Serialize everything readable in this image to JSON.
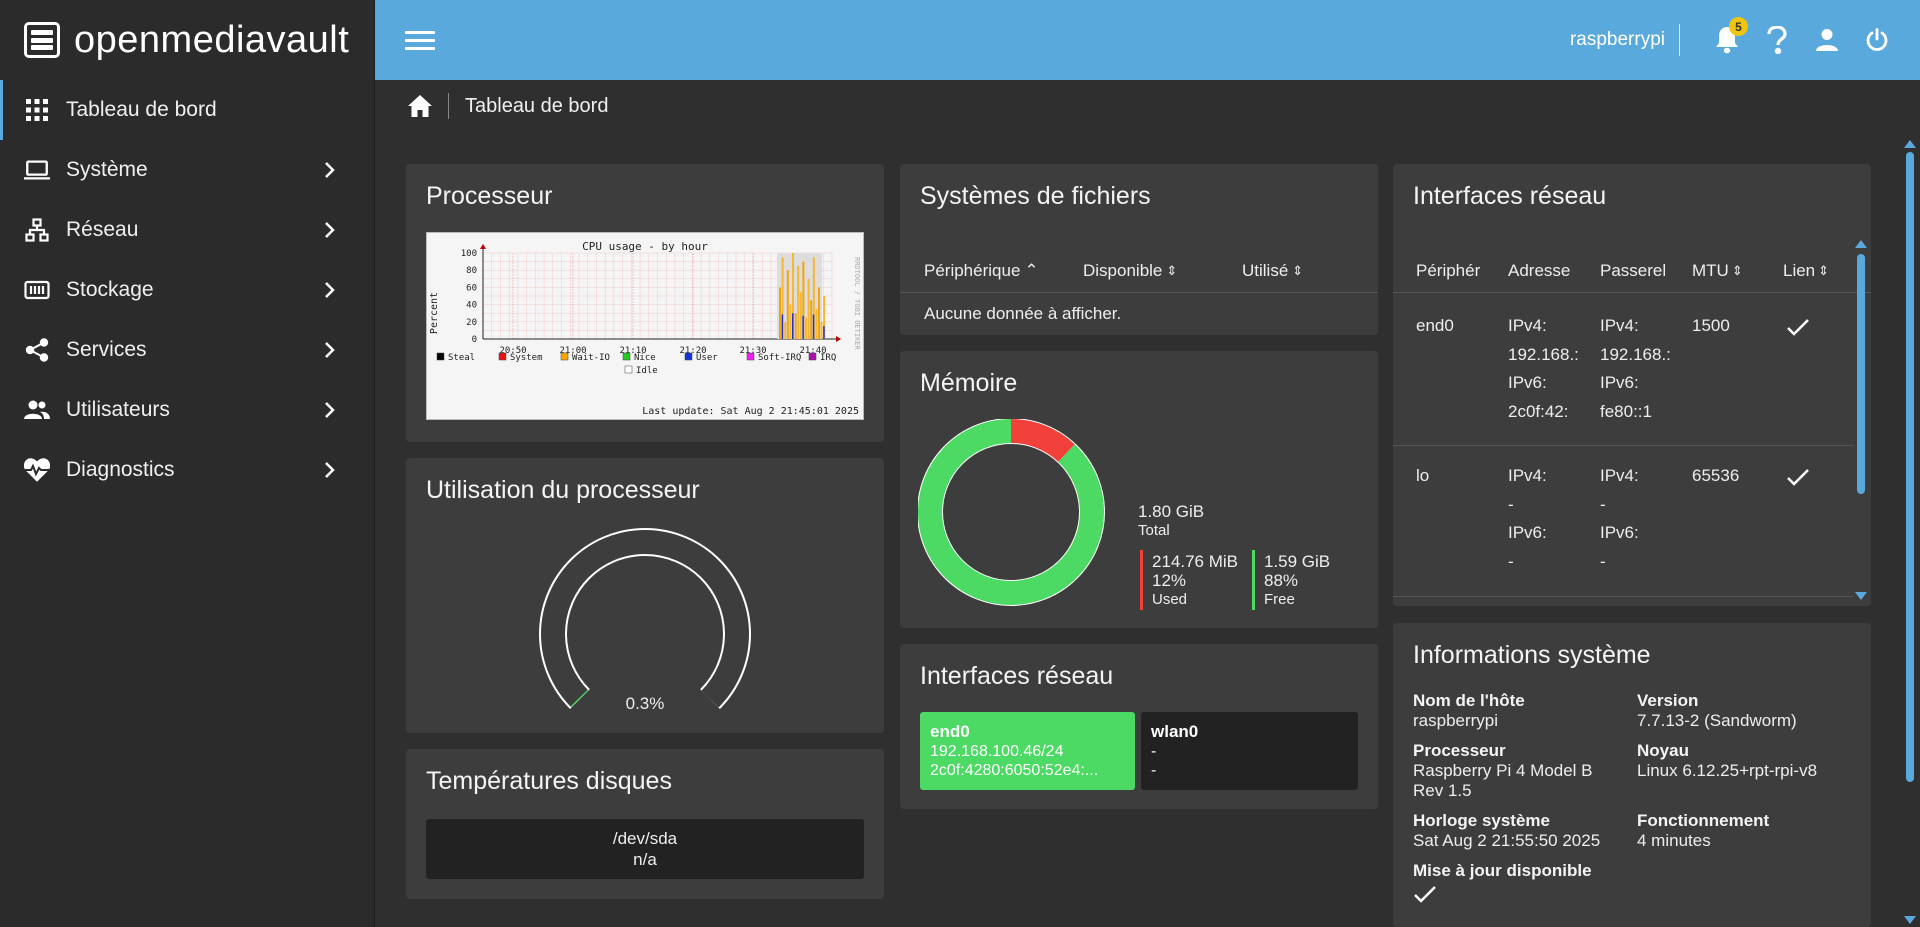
{
  "app": {
    "name": "openmediavault"
  },
  "sidebar": {
    "items": [
      {
        "label": "Tableau de bord",
        "icon": "dashboard-icon"
      },
      {
        "label": "Système",
        "icon": "laptop-icon"
      },
      {
        "label": "Réseau",
        "icon": "network-icon"
      },
      {
        "label": "Stockage",
        "icon": "storage-icon"
      },
      {
        "label": "Services",
        "icon": "share-icon"
      },
      {
        "label": "Utilisateurs",
        "icon": "users-icon"
      },
      {
        "label": "Diagnostics",
        "icon": "heartbeat-icon"
      }
    ]
  },
  "topbar": {
    "hostname": "raspberrypi",
    "notifications": "5"
  },
  "breadcrumb": {
    "current": "Tableau de bord"
  },
  "processor": {
    "title": "Processeur",
    "chart": {
      "title": "CPU usage - by hour",
      "ylabel": "Percent",
      "yticks": [
        "100",
        "80",
        "60",
        "40",
        "20",
        "0"
      ],
      "xticks": [
        "20:50",
        "21:00",
        "21:10",
        "21:20",
        "21:30",
        "21:40"
      ],
      "side_label": "RRDTOOL / TOBI OETIKER",
      "legend": [
        "Steal",
        "System",
        "Wait-IO",
        "Nice",
        "User",
        "Soft-IRQ",
        "IRQ",
        "Idle"
      ],
      "last_update": "Last update: Sat Aug  2 21:45:01 2025"
    }
  },
  "cpu_usage": {
    "title": "Utilisation du processeur",
    "value": "0.3%",
    "fraction": 0.003
  },
  "disk_temps": {
    "title": "Températures disques",
    "device": "/dev/sda",
    "value": "n/a"
  },
  "filesystems": {
    "title": "Systèmes de fichiers",
    "columns": [
      "Périphérique",
      "Disponible",
      "Utilisé"
    ],
    "empty": "Aucune donnée à afficher."
  },
  "memory": {
    "title": "Mémoire",
    "total": "1.80 GiB",
    "total_label": "Total",
    "used": "214.76 MiB",
    "used_pct": "12%",
    "used_label": "Used",
    "free": "1.59 GiB",
    "free_pct": "88%",
    "free_label": "Free",
    "used_fraction": 0.12,
    "colors": {
      "used": "#f2413a",
      "free": "#4cd964"
    }
  },
  "net_tiles": {
    "title": "Interfaces réseau",
    "tiles": [
      {
        "name": "end0",
        "line1": "192.168.100.46/24",
        "line2": "2c0f:4280:6050:52e4:...",
        "color": "#4cd964"
      },
      {
        "name": "wlan0",
        "line1": "-",
        "line2": "-",
        "color": "#222222"
      }
    ]
  },
  "net_table": {
    "title": "Interfaces réseau",
    "columns": [
      "Périphér",
      "Adresse",
      "Passerel",
      "MTU",
      "Lien"
    ],
    "rows": [
      {
        "device": "end0",
        "addr": [
          "IPv4:",
          "192.168.:",
          "IPv6:",
          "2c0f:42:"
        ],
        "gw": [
          "IPv4:",
          "192.168.:",
          "IPv6:",
          "fe80::1"
        ],
        "mtu": "1500"
      },
      {
        "device": "lo",
        "addr": [
          "IPv4:",
          "-",
          "IPv6:",
          "-"
        ],
        "gw": [
          "IPv4:",
          "-",
          "IPv6:",
          "-"
        ],
        "mtu": "65536"
      }
    ]
  },
  "sysinfo": {
    "title": "Informations système",
    "hostname_label": "Nom de l'hôte",
    "hostname": "raspberrypi",
    "version_label": "Version",
    "version": "7.7.13-2 (Sandworm)",
    "cpu_label": "Processeur",
    "cpu_line1": "Raspberry Pi 4 Model B",
    "cpu_line2": "Rev 1.5",
    "kernel_label": "Noyau",
    "kernel": "Linux 6.12.25+rpt-rpi-v8",
    "clock_label": "Horloge système",
    "clock": "Sat Aug 2 21:55:50 2025",
    "uptime_label": "Fonctionnement",
    "uptime": "4 minutes",
    "update_label": "Mise à jour disponible"
  }
}
